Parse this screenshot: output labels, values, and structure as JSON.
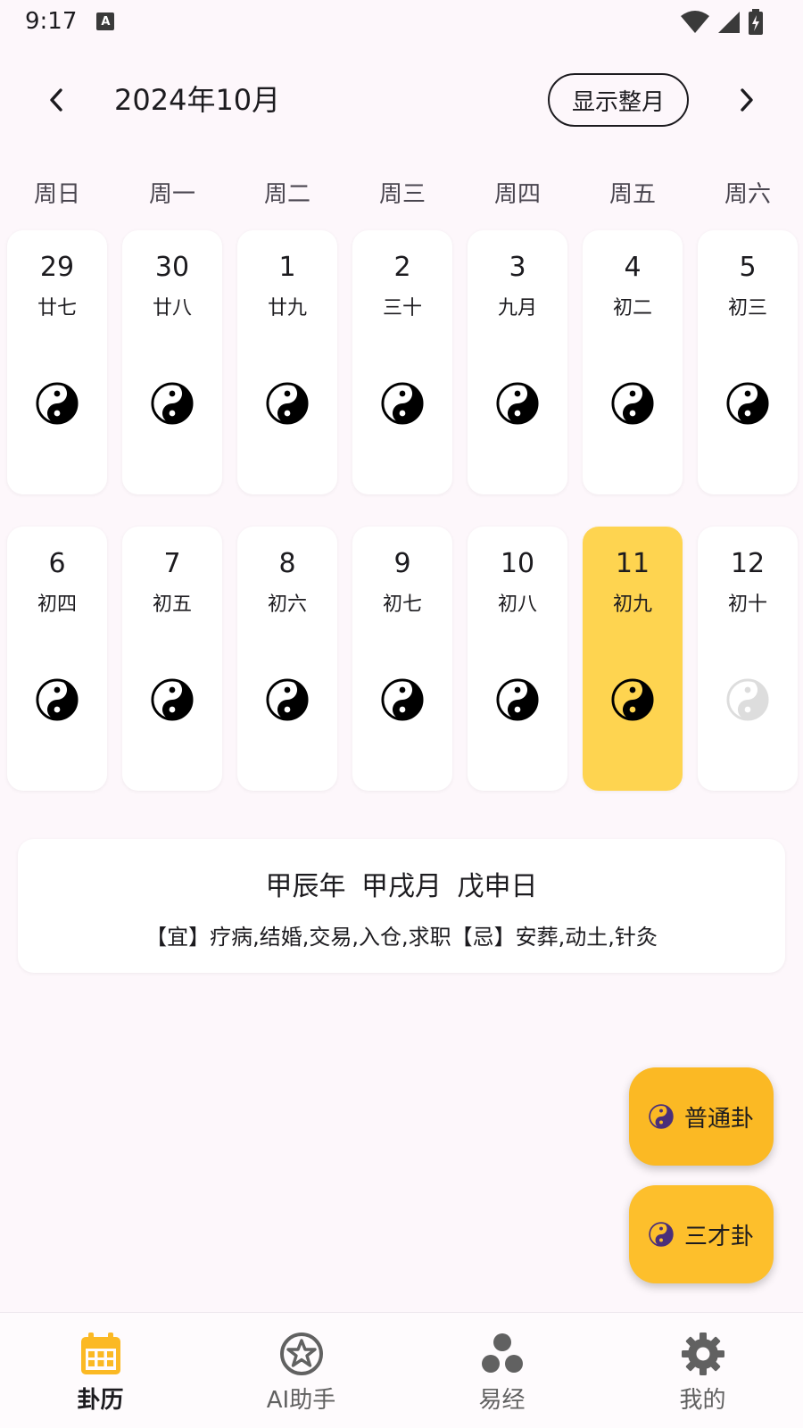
{
  "status": {
    "time": "9:17",
    "a_icon": "A"
  },
  "header": {
    "title": "2024年10月",
    "show_month_label": "显示整月"
  },
  "weekdays": [
    "周日",
    "周一",
    "周二",
    "周三",
    "周四",
    "周五",
    "周六"
  ],
  "weeks": [
    [
      {
        "day": "29",
        "lunar": "廿七"
      },
      {
        "day": "30",
        "lunar": "廿八"
      },
      {
        "day": "1",
        "lunar": "廿九"
      },
      {
        "day": "2",
        "lunar": "三十"
      },
      {
        "day": "3",
        "lunar": "九月"
      },
      {
        "day": "4",
        "lunar": "初二"
      },
      {
        "day": "5",
        "lunar": "初三"
      }
    ],
    [
      {
        "day": "6",
        "lunar": "初四"
      },
      {
        "day": "7",
        "lunar": "初五"
      },
      {
        "day": "8",
        "lunar": "初六"
      },
      {
        "day": "9",
        "lunar": "初七"
      },
      {
        "day": "10",
        "lunar": "初八"
      },
      {
        "day": "11",
        "lunar": "初九",
        "selected": true
      },
      {
        "day": "12",
        "lunar": "初十",
        "faded": true
      }
    ]
  ],
  "info": {
    "ganzhi": "甲辰年 甲戌月 戊申日",
    "yi_ji": "【宜】疗病,结婚,交易,入仓,求职【忌】安葬,动土,针灸"
  },
  "fabs": [
    {
      "label": "普通卦",
      "icon": "yin-yang-icon"
    },
    {
      "label": "三才卦",
      "icon": "yin-yang-icon"
    }
  ],
  "bottom_nav": [
    {
      "label": "卦历",
      "icon": "calendar-icon",
      "active": true
    },
    {
      "label": "AI助手",
      "icon": "star-circle-icon"
    },
    {
      "label": "易经",
      "icon": "three-dots-icon"
    },
    {
      "label": "我的",
      "icon": "gear-icon"
    }
  ],
  "colors": {
    "selected_day": "#fed450",
    "fab": "#fbb924",
    "nav_active": "#fbb924",
    "nav_inactive": "#616161",
    "background": "#fdf7fb"
  }
}
